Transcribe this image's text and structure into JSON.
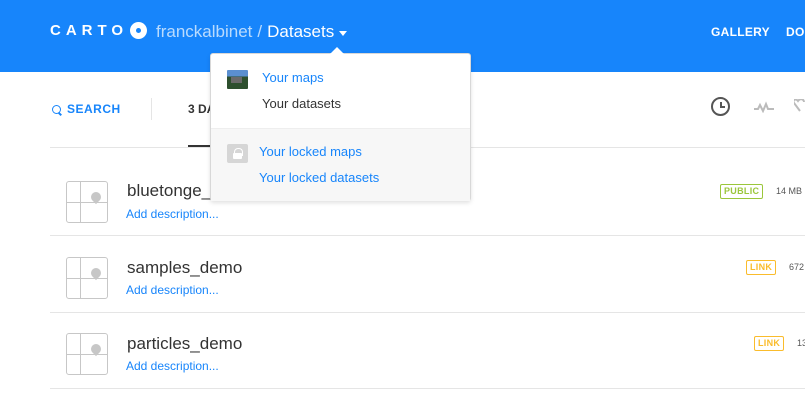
{
  "header": {
    "logo_text": "CARTO",
    "breadcrumb": {
      "user": "franckalbinet",
      "separator": "/",
      "current": "Datasets"
    },
    "nav": [
      "GALLERY",
      "DO"
    ]
  },
  "filterbar": {
    "search_label": "SEARCH",
    "count_tab": "3 DA",
    "icons": [
      "clock-icon",
      "pulse-icon",
      "heart-icon"
    ]
  },
  "dropdown": {
    "items": [
      {
        "label": "Your maps",
        "style": "link"
      },
      {
        "label": "Your datasets",
        "style": "plain"
      },
      {
        "label": "Your locked maps",
        "style": "link"
      },
      {
        "label": "Your locked datasets",
        "style": "link"
      }
    ]
  },
  "datasets": [
    {
      "name": "bluetonge_",
      "description": "Add description...",
      "privacy": "PUBLIC",
      "size": "14 MB"
    },
    {
      "name": "samples_demo",
      "description": "Add description...",
      "privacy": "LINK",
      "size": "672"
    },
    {
      "name": "particles_demo",
      "description": "Add description...",
      "privacy": "LINK",
      "size": "13"
    }
  ],
  "colors": {
    "brand": "#1785fb",
    "public": "#9bc63b",
    "link": "#fabc2c"
  }
}
